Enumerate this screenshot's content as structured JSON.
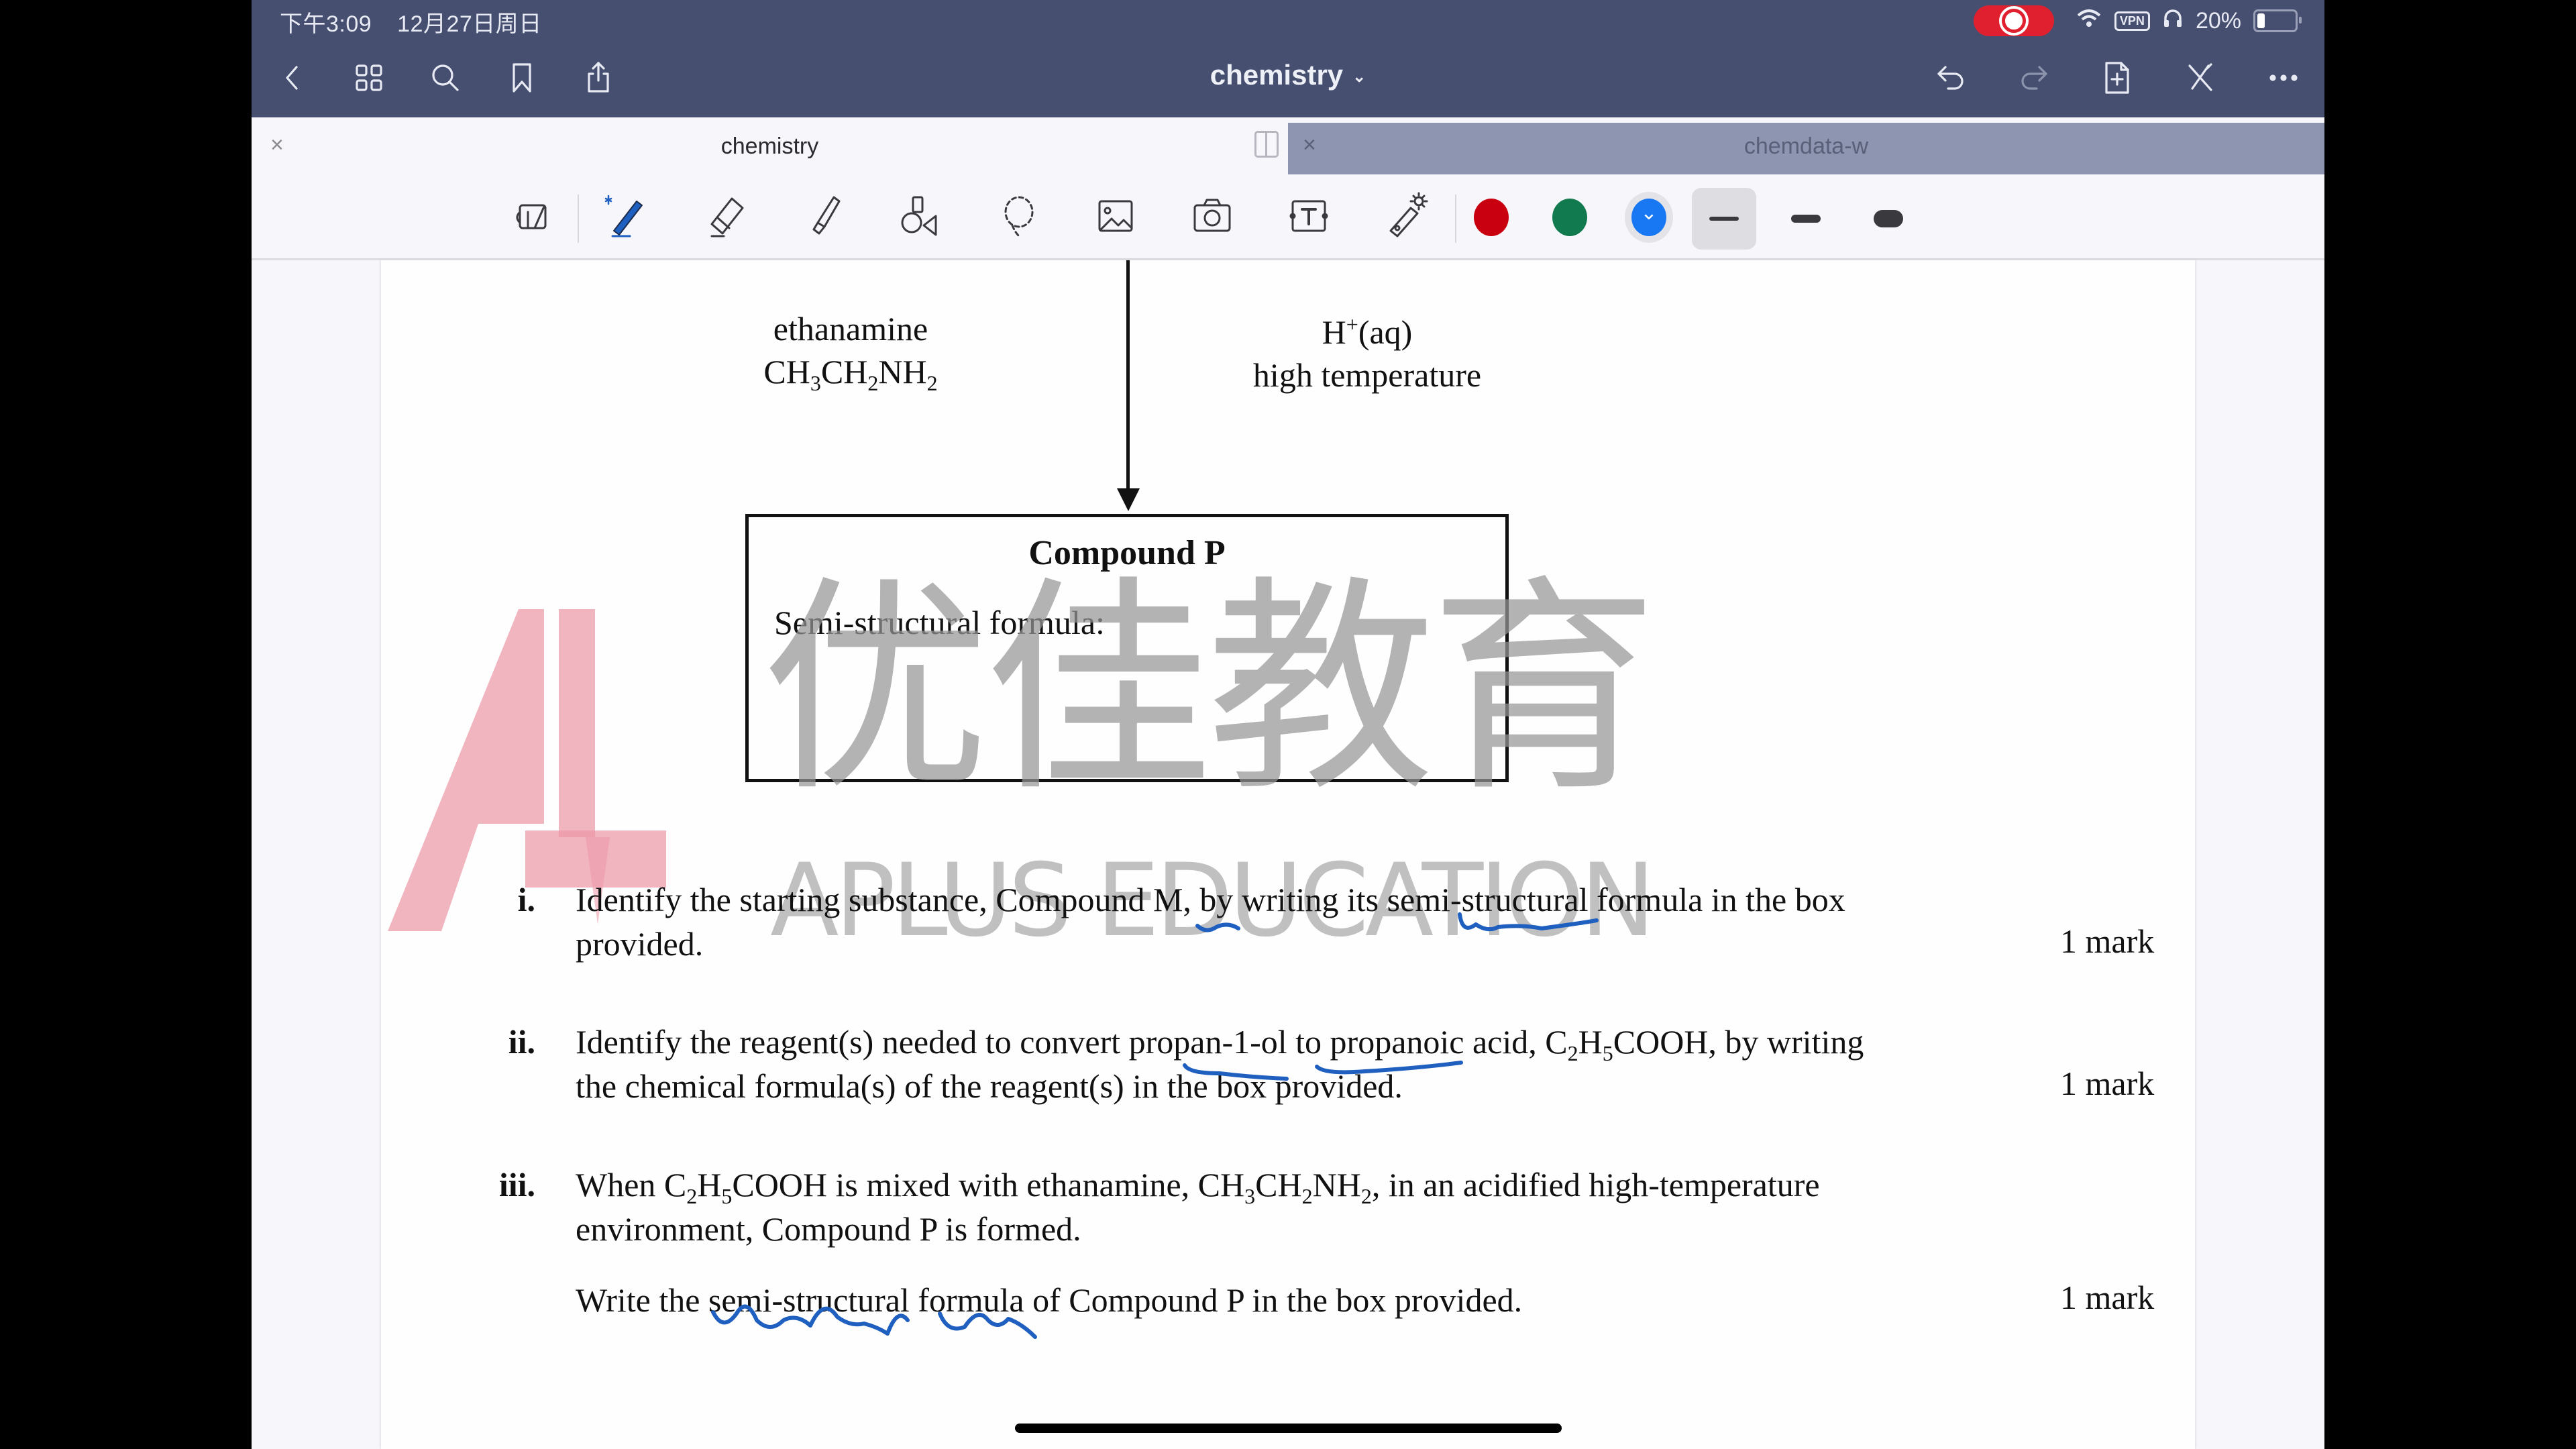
{
  "status_bar": {
    "time": "下午3:09",
    "date": "12月27日周日",
    "recording": true,
    "vpn_label": "VPN",
    "battery_percent": "20%",
    "battery_level": 0.2
  },
  "nav": {
    "title": "chemistry",
    "left_icons": [
      "back-icon",
      "grid-icon",
      "search-icon",
      "bookmark-icon",
      "share-icon"
    ],
    "right_icons": [
      "undo-icon",
      "redo-icon",
      "add-page-icon",
      "pen-off-icon",
      "more-icon"
    ]
  },
  "tabs": [
    {
      "label": "chemistry",
      "active": true,
      "close": "×"
    },
    {
      "label": "chemdata-w",
      "active": false,
      "close": "×"
    }
  ],
  "toolbar": {
    "tools": [
      "read-only-icon",
      "pen-icon",
      "eraser-icon",
      "highlighter-icon",
      "shapes-icon",
      "lasso-icon",
      "image-icon",
      "camera-icon",
      "text-box-icon",
      "laser-pointer-icon"
    ],
    "selected_tool": "pen-icon",
    "colors": [
      {
        "name": "red",
        "hex": "#c8000f"
      },
      {
        "name": "green",
        "hex": "#127a4f"
      },
      {
        "name": "blue",
        "hex": "#1877f2",
        "selected": true
      }
    ],
    "stroke_widths": [
      "thin",
      "medium",
      "thick"
    ],
    "selected_width": "thin"
  },
  "document": {
    "reagent_left": {
      "line1": "ethanamine",
      "formula": [
        "CH",
        "3",
        "CH",
        "2",
        "NH",
        "2"
      ]
    },
    "reagent_right": {
      "line1_base": "H",
      "line1_sup": "+",
      "line1_rest": "(aq)",
      "line2": "high temperature"
    },
    "box": {
      "title": "Compound P",
      "label": "Semi-structural formula:"
    },
    "watermark": {
      "cn": "优佳教育",
      "en": "APLUS EDUCATION"
    },
    "questions": [
      {
        "num": "i.",
        "line1": "Identify the starting substance, Compound M, by writing its semi-structural formula in the box",
        "line2": "provided.",
        "mark": "1 mark"
      },
      {
        "num": "ii.",
        "line1_a": "Identify the reagent(s) needed to convert propan-1-ol to propanoic acid, C",
        "line1_sub1": "2",
        "line1_b": "H",
        "line1_sub2": "5",
        "line1_c": "COOH, by writing",
        "line2": "the chemical formula(s) of the reagent(s) in the box provided.",
        "mark": "1 mark"
      },
      {
        "num": "iii.",
        "line1_a": "When C",
        "line1_s1": "2",
        "line1_b": "H",
        "line1_s2": "5",
        "line1_c": "COOH is mixed with ethanamine, CH",
        "line1_s3": "3",
        "line1_d": "CH",
        "line1_s4": "2",
        "line1_e": "NH",
        "line1_s5": "2",
        "line1_f": ", in an acidified high-temperature",
        "line2": "environment, Compound P is formed.",
        "line3": "Write the semi-structural formula of Compound P in the box provided.",
        "mark": "1 mark"
      }
    ]
  }
}
